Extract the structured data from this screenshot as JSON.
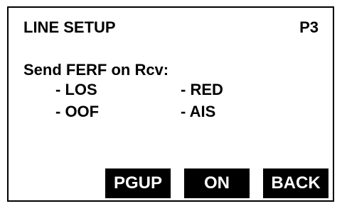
{
  "header": {
    "title": "LINE SETUP",
    "page": "P3"
  },
  "setting": {
    "label": "Send FERF on Rcv:",
    "options": [
      "- LOS",
      "- RED",
      "- OOF",
      "- AIS"
    ]
  },
  "softkeys": {
    "pgup": "PGUP",
    "on": "ON",
    "back": "BACK"
  },
  "colors": {
    "foreground": "#000000",
    "background": "#ffffff",
    "softkey_text": "#ffffff"
  }
}
